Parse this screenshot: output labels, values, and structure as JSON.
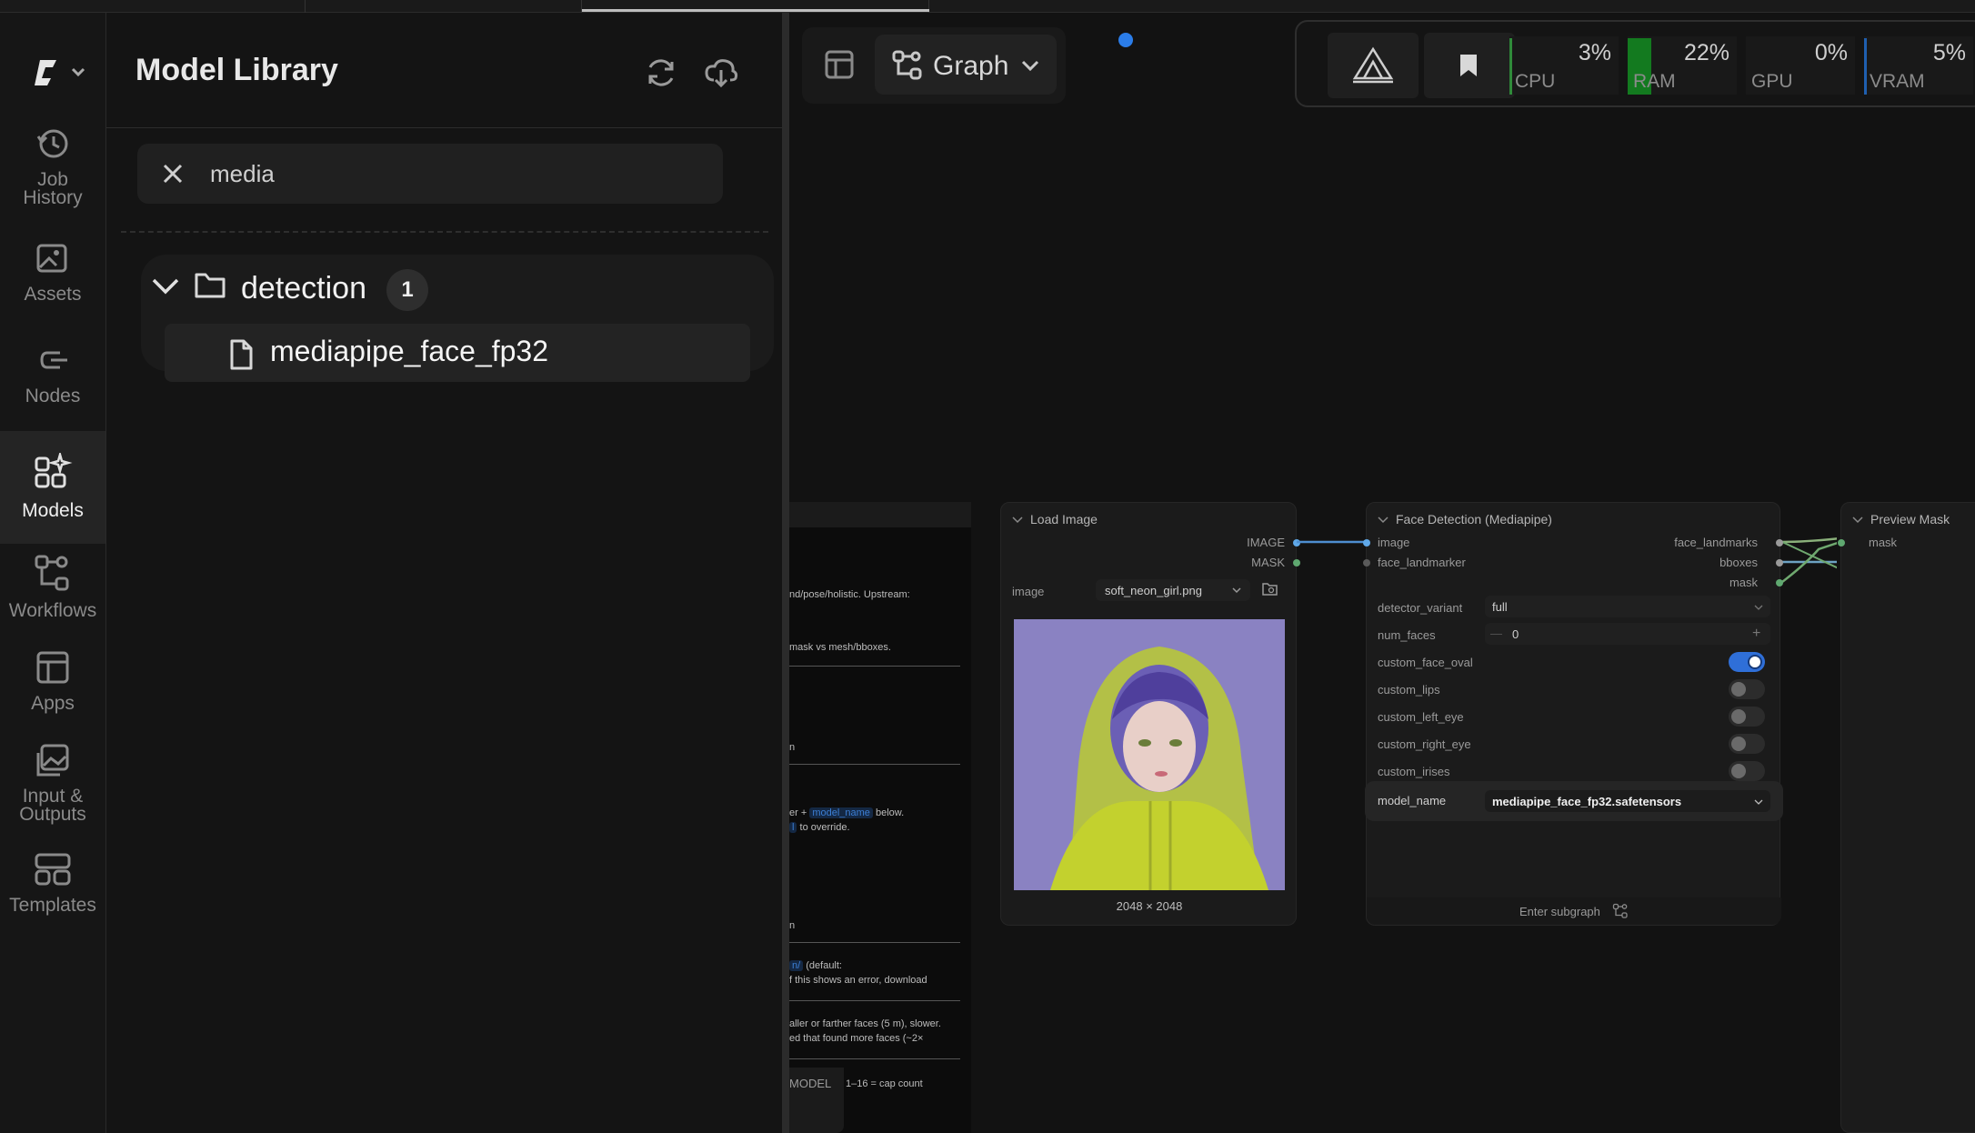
{
  "library": {
    "title": "Model Library",
    "search_value": "media",
    "folder": {
      "name": "detection",
      "count": "1"
    },
    "file": {
      "name": "mediapipe_face_fp32"
    }
  },
  "rail": {
    "items": [
      {
        "label_line1": "Job",
        "label_line2": "History"
      },
      {
        "label_line1": "Assets"
      },
      {
        "label_line1": "Nodes"
      },
      {
        "label_line1": "Models"
      },
      {
        "label_line1": "Workflows"
      },
      {
        "label_line1": "Apps"
      },
      {
        "label_line1": "Input &",
        "label_line2": "Outputs"
      },
      {
        "label_line1": "Templates"
      }
    ]
  },
  "toolbar": {
    "graph_label": "Graph"
  },
  "stats": {
    "cpu": {
      "label": "CPU",
      "value": "3%"
    },
    "ram": {
      "label": "RAM",
      "value": "22%"
    },
    "gpu": {
      "label": "GPU",
      "value": "0%"
    },
    "vram": {
      "label": "VRAM",
      "value": "5%"
    }
  },
  "nodes": {
    "load_image": {
      "title": "Load Image",
      "out_image": "IMAGE",
      "out_mask": "MASK",
      "widget_label": "image",
      "widget_value": "soft_neon_girl.png",
      "dims": "2048 × 2048"
    },
    "face_detection": {
      "title": "Face Detection (Mediapipe)",
      "in_image": "image",
      "in_landmarker": "face_landmarker",
      "out_landmarks": "face_landmarks",
      "out_bboxes": "bboxes",
      "out_mask": "mask",
      "detector_variant_label": "detector_variant",
      "detector_variant_value": "full",
      "num_faces_label": "num_faces",
      "num_faces_value": "0",
      "custom_face_oval": "custom_face_oval",
      "custom_lips": "custom_lips",
      "custom_left_eye": "custom_left_eye",
      "custom_right_eye": "custom_right_eye",
      "custom_irises": "custom_irises",
      "model_name_label": "model_name",
      "model_name_value": "mediapipe_face_fp32.safetensors",
      "subgraph": "Enter subgraph"
    },
    "preview_mask": {
      "title": "Preview Mask",
      "in_mask": "mask"
    },
    "note": {
      "l1": "nd/pose/holistic. Upstream:",
      "l2": "mask vs mesh/bboxes.",
      "l3": "n",
      "l4a": "er + ",
      "l4code": "model_name",
      "l4b": " below.",
      "l5code": "l",
      "l5b": " to override.",
      "l6": "n",
      "l7code": "n/",
      "l7b": " (default:",
      "l8": "f this shows an error, download",
      "l9": "aller or farther faces (5 m), slower.",
      "l10": "ed that found more faces (~2×",
      "l11a": "MODEL",
      "l11b": "1–16 = cap count"
    }
  }
}
